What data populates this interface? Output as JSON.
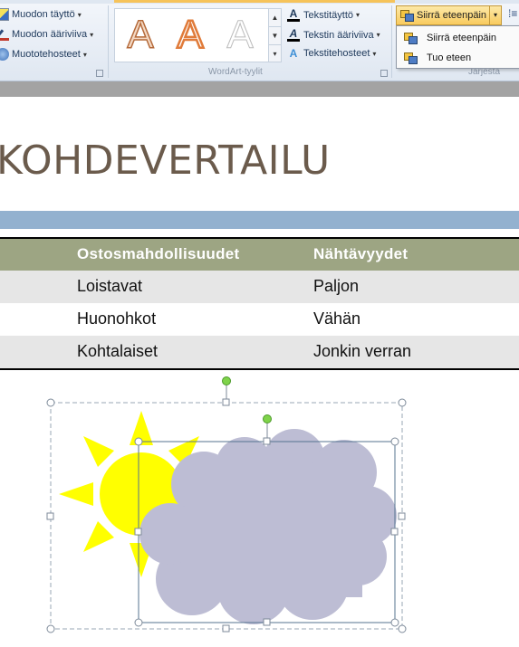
{
  "ribbon": {
    "shape_styles": {
      "fill_label": "Muodon täyttö",
      "outline_label": "Muodon ääriviiva",
      "effects_label": "Muototehosteet"
    },
    "wordart": {
      "gallery_letters": [
        "A",
        "A",
        "A"
      ],
      "text_fill_label": "Tekstitäyttö",
      "text_outline_label": "Tekstin ääriviiva",
      "text_effects_label": "Tekstitehosteet",
      "group_label": "WordArt-tyylit"
    },
    "arrange": {
      "bring_forward_label": "Siirrä eteenpäin",
      "group_label": "Järjestä"
    },
    "dropdown": {
      "items": [
        "Siirrä eteenpäin",
        "Tuo eteen"
      ]
    }
  },
  "slide": {
    "title": "KOHDEVERTAILU",
    "table": {
      "headers": [
        "Ostosmahdollisuudet",
        "Nähtävyydet"
      ],
      "rows": [
        [
          "Loistavat",
          "Paljon"
        ],
        [
          "Huonohkot",
          "Vähän"
        ],
        [
          "Kohtalaiset",
          "Jonkin verran"
        ]
      ]
    },
    "shapes": {
      "sun_color": "#ffff00",
      "cloud_color": "#bdbdd4",
      "handle_rotate_color": "#7fd34a"
    }
  },
  "colors": {
    "title": "#6b5b4c",
    "blue_bar": "#93b1cf",
    "table_header": "#9da583",
    "table_alt_row": "#e6e6e6",
    "ribbon_highlight": "#f9cb5e"
  }
}
